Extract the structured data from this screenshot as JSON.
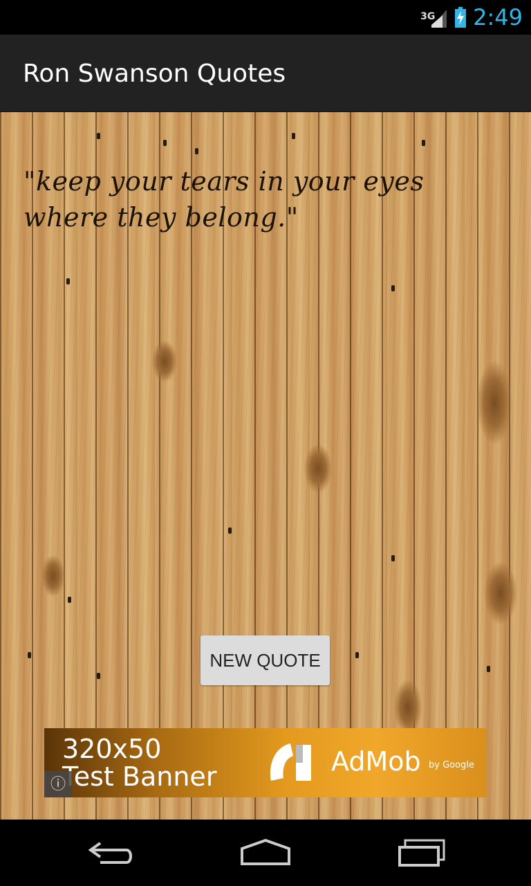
{
  "status_bar": {
    "network_type": "3G",
    "time": "2:49",
    "icons": [
      "signal-icon",
      "battery-charging-icon"
    ]
  },
  "action_bar": {
    "title": "Ron Swanson Quotes"
  },
  "main": {
    "quote": "\"keep your tears in your eyes where they belong.\"",
    "new_quote_label": "NEW QUOTE"
  },
  "ad": {
    "size_text": "320x50",
    "banner_text": "Test Banner",
    "brand": "AdMob",
    "by_google": "by Google",
    "info_icon": "info-icon"
  },
  "nav_bar": {
    "icons": [
      "back-icon",
      "home-icon",
      "recent-apps-icon"
    ]
  },
  "colors": {
    "clock": "#33b5e5",
    "action_bar": "#222222",
    "button": "#dcdcdc"
  }
}
